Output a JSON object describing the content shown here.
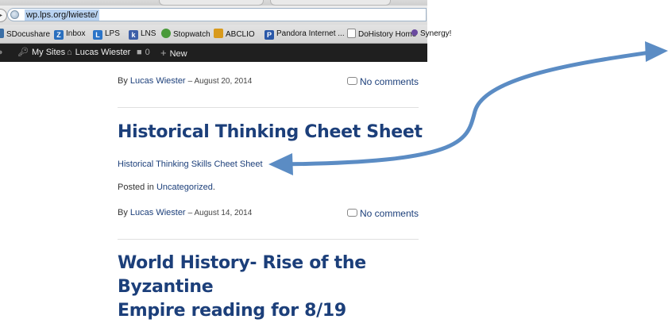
{
  "browser": {
    "url": "wp.lps.org/lwieste/",
    "bookmarks": [
      {
        "label": "SDocushare",
        "icon": "sdocushare-icon",
        "color": "#3a6ea5"
      },
      {
        "label": "Inbox",
        "icon": "zimbra-icon",
        "color": "#2a6fbe"
      },
      {
        "label": "LPS",
        "icon": "lps-icon",
        "color": "#2a74c8"
      },
      {
        "label": "LNS",
        "icon": "lns-icon",
        "color": "#3d5fa8"
      },
      {
        "label": "Stopwatch",
        "icon": "stopwatch-icon",
        "color": "#4a9a3a"
      },
      {
        "label": "ABCLIO",
        "icon": "abclio-icon",
        "color": "#d89a1c"
      },
      {
        "label": "Pandora Internet ...",
        "icon": "pandora-icon",
        "color": "#2a58a8"
      },
      {
        "label": "DoHistory Home",
        "icon": "page-icon",
        "color": "#ffffff"
      },
      {
        "label": "Synergy!",
        "icon": "synergy-icon",
        "color": "#6a4aa0"
      }
    ]
  },
  "admin_bar": {
    "my_sites": "My Sites",
    "site_name": "Lucas Wiester",
    "comments_count": "0",
    "new_label": "New"
  },
  "posts": [
    {
      "author_prefix": "By",
      "author": "Lucas Wiester",
      "date": "– August 20, 2014",
      "comments": "No comments"
    },
    {
      "title": "Historical Thinking Cheet Sheet",
      "link": "Historical Thinking Skills Cheet Sheet",
      "posted_prefix": "Posted in",
      "category": "Uncategorized",
      "category_suffix": ".",
      "author_prefix": "By",
      "author": "Lucas Wiester",
      "date": "– August 14, 2014",
      "comments": "No comments"
    },
    {
      "title_line1": "World History- Rise of the Byzantine",
      "title_line2": "Empire reading for 8/19"
    }
  ],
  "colors": {
    "link": "#1c3f7a",
    "arrow": "#5b8cc4",
    "admin_bar": "#1f1f1f"
  }
}
